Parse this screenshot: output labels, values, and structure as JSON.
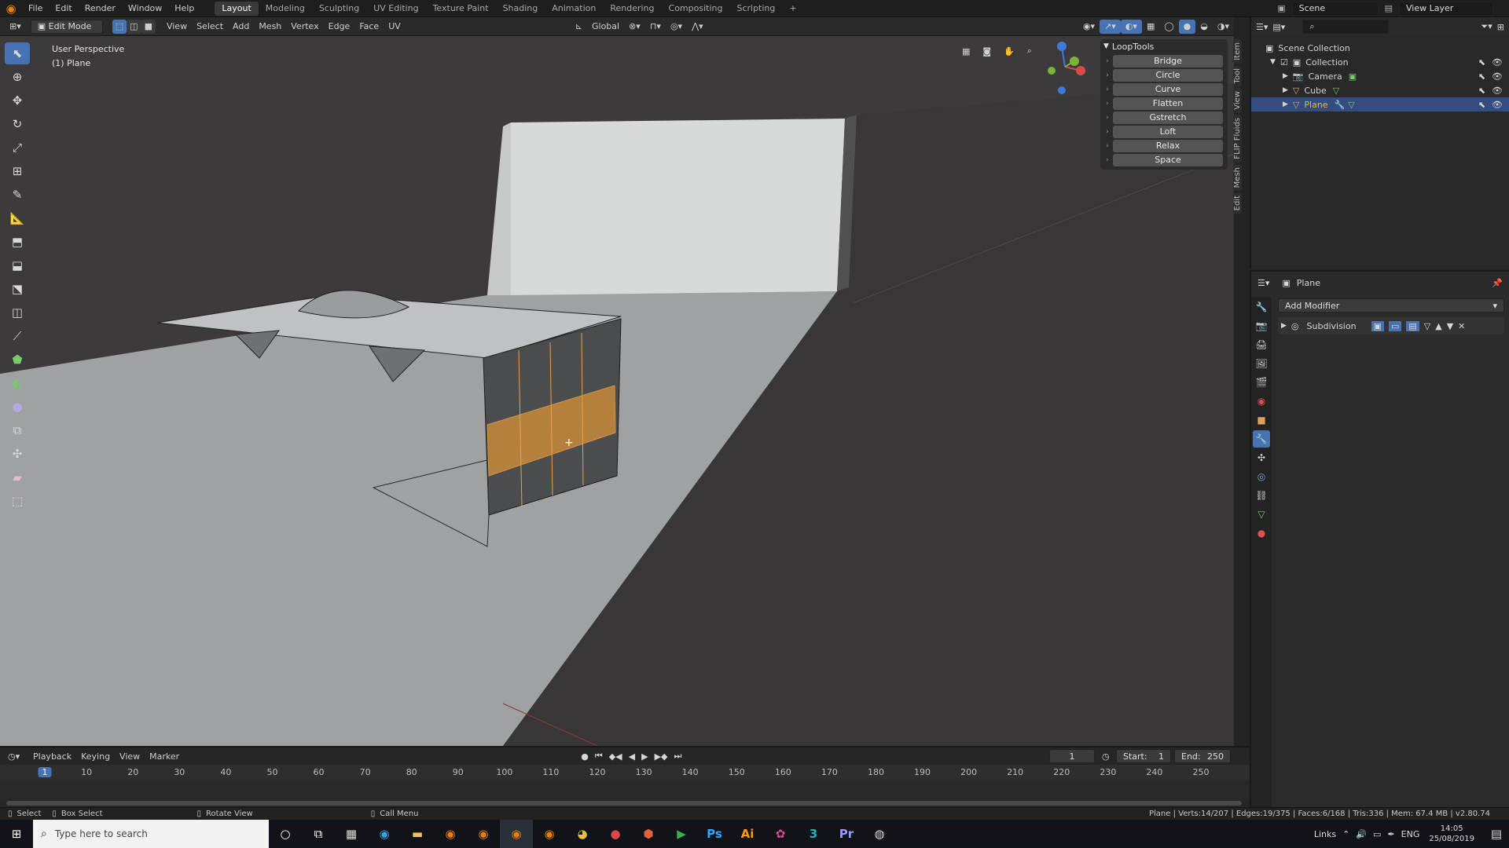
{
  "app": {
    "menus": [
      "File",
      "Edit",
      "Render",
      "Window",
      "Help"
    ],
    "workspaces": [
      "Layout",
      "Modeling",
      "Sculpting",
      "UV Editing",
      "Texture Paint",
      "Shading",
      "Animation",
      "Rendering",
      "Compositing",
      "Scripting"
    ],
    "active_workspace": "Layout",
    "add_workspace": "+",
    "scene": "Scene",
    "view_layer": "View Layer"
  },
  "header": {
    "mode": "Edit Mode",
    "menus": [
      "View",
      "Select",
      "Add",
      "Mesh",
      "Vertex",
      "Edge",
      "Face",
      "UV"
    ],
    "orientation": "Global"
  },
  "viewport": {
    "perspective": "User Perspective",
    "object": "(1) Plane"
  },
  "looptools": {
    "title": "LoopTools",
    "items": [
      "Bridge",
      "Circle",
      "Curve",
      "Flatten",
      "Gstretch",
      "Loft",
      "Relax",
      "Space"
    ]
  },
  "side_tabs": [
    "Item",
    "Tool",
    "View",
    "FLIP Fluids",
    "Mesh",
    "Edit"
  ],
  "outliner": {
    "root": "Scene Collection",
    "collection": "Collection",
    "objects": [
      "Camera",
      "Cube",
      "Plane"
    ]
  },
  "properties": {
    "object_name": "Plane",
    "add_modifier": "Add Modifier",
    "modifier": "Subdivision"
  },
  "timeline": {
    "menus": [
      "Playback",
      "Keying",
      "View",
      "Marker"
    ],
    "current_frame": "1",
    "start_label": "Start:",
    "start": "1",
    "end_label": "End:",
    "end": "250",
    "ticks": [
      "1",
      "10",
      "20",
      "30",
      "40",
      "50",
      "60",
      "70",
      "80",
      "90",
      "100",
      "110",
      "120",
      "130",
      "140",
      "150",
      "160",
      "170",
      "180",
      "190",
      "200",
      "210",
      "220",
      "230",
      "240",
      "250"
    ]
  },
  "status": {
    "select": "Select",
    "box_select": "Box Select",
    "rotate_view": "Rotate View",
    "call_menu": "Call Menu",
    "stats": "Plane | Verts:14/207 | Edges:19/375 | Faces:6/168 | Tris:336 | Mem: 67.4 MB | v2.80.74"
  },
  "taskbar": {
    "search_placeholder": "Type here to search",
    "links": "Links",
    "lang": "ENG",
    "time": "14:05",
    "date": "25/08/2019"
  },
  "colors": {
    "accent": "#4772b3",
    "selection": "#e8a04a",
    "brand": "#e87d0d"
  }
}
